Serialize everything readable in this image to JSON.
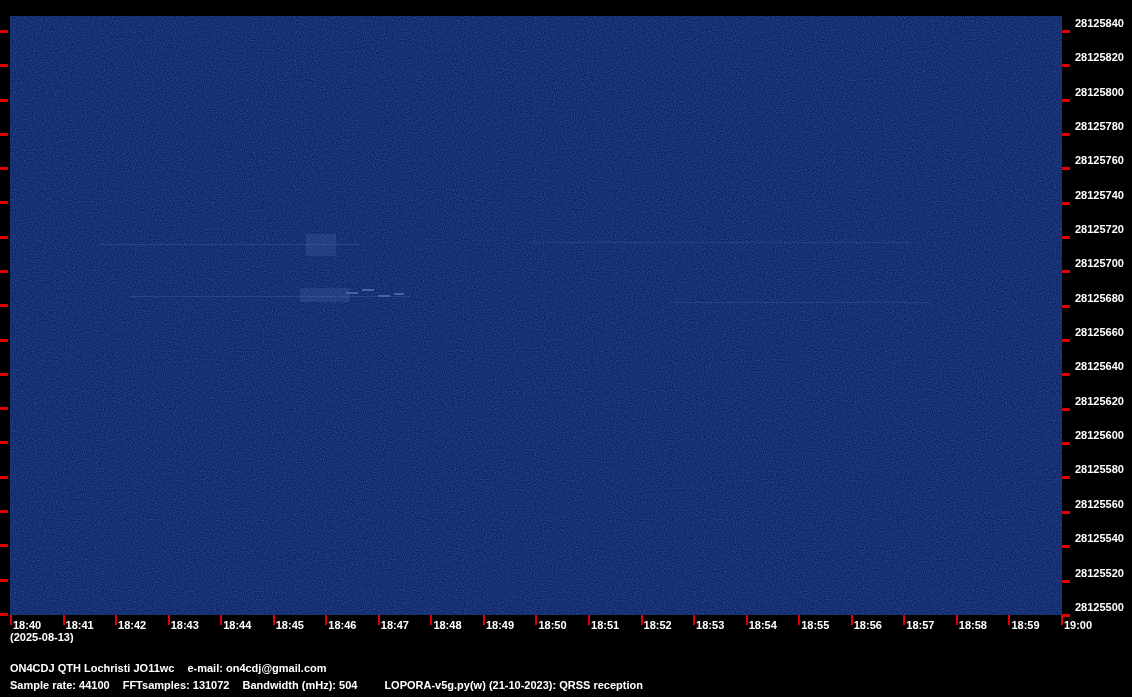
{
  "frequency_axis": {
    "labels": [
      "28125840",
      "28125820",
      "28125800",
      "28125780",
      "28125760",
      "28125740",
      "28125720",
      "28125700",
      "28125680",
      "28125660",
      "28125640",
      "28125620",
      "28125600",
      "28125580",
      "28125560",
      "28125540",
      "28125520",
      "28125500"
    ]
  },
  "time_axis": {
    "labels": [
      "18:40",
      "18:41",
      "18:42",
      "18:43",
      "18:44",
      "18:45",
      "18:46",
      "18:47",
      "18:48",
      "18:49",
      "18:50",
      "18:51",
      "18:52",
      "18:53",
      "18:54",
      "18:55",
      "18:56",
      "18:57",
      "18:58",
      "18:59",
      "19:00"
    ],
    "date": "(2025-08-13)"
  },
  "footer": {
    "lines": [
      {
        "items": [
          "ON4CDJ QTH Lochristi JO11wc",
          "e-mail: on4cdj@gmail.com"
        ]
      },
      {
        "items": [
          "Sample rate: 44100",
          "FFTsamples: 131072",
          "Bandwidth (mHz): 504",
          "LOPORA-v5g.py(w) (21-10-2023): QRSS reception"
        ]
      }
    ]
  }
}
